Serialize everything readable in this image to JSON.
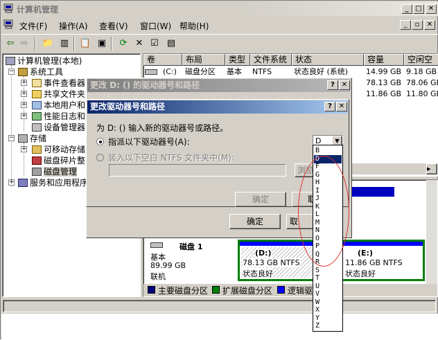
{
  "window": {
    "title": "计算机管理"
  },
  "menu": [
    "文件(F)",
    "操作(A)",
    "查看(V)",
    "窗口(W)",
    "帮助(H)"
  ],
  "tree": {
    "root": "计算机管理(本地)",
    "system_tools": "系统工具",
    "event_viewer": "事件查看器",
    "shared_folders": "共享文件夹",
    "local_users": "本地用户和",
    "perf_logs": "性能日志和",
    "device_manager": "设备管理器",
    "storage": "存储",
    "removable": "可移动存储",
    "defrag": "磁盘碎片整",
    "disk_mgmt": "磁盘管理",
    "services": "服务和应用程序"
  },
  "columns": [
    "卷",
    "布局",
    "类型",
    "文件系统",
    "状态",
    "容量",
    "空闲空"
  ],
  "volumes": [
    {
      "vol": "(C:)",
      "layout": "磁盘分区",
      "type": "基本",
      "fs": "NTFS",
      "status": "状态良好 (系统)",
      "cap": "14.99 GB",
      "free": "9.18 GB"
    },
    {
      "vol": "",
      "layout": "",
      "type": "",
      "fs": "",
      "status": "",
      "cap": "78.13 GB",
      "free": "78.06 GB"
    },
    {
      "vol": "",
      "layout": "",
      "type": "",
      "fs": "",
      "status": "",
      "cap": "11.86 GB",
      "free": "11.80 GB"
    }
  ],
  "disk1": {
    "name": "磁盘 1",
    "kind": "基本",
    "size": "89.99 GB",
    "state": "联机",
    "part_d_label": "(D:)",
    "part_d_size": "78.13 GB NTFS",
    "part_d_status": "状态良好",
    "part_e_label": "(E:)",
    "part_e_size": "11.86 GB NTFS",
    "part_e_status": "状态良好"
  },
  "legend": [
    "主要磁盘分区",
    "扩展磁盘分区",
    "逻辑驱"
  ],
  "dialog1": {
    "title": "更改 D: () 的驱动器号和路径",
    "ok": "确定",
    "cancel": "取"
  },
  "dialog2": {
    "title": "更改驱动器号和路径",
    "prompt": "为 D: () 输入新的驱动器号或路径。",
    "opt_letter": "指派以下驱动器号(A):",
    "opt_folder": "装入以下空白 NTFS 文件夹中(M):",
    "browse": "浏览",
    "ok": "确定",
    "cancel": "取",
    "selected_letter": "D"
  },
  "drive_letters": [
    "B",
    "D",
    "F",
    "G",
    "H",
    "I",
    "J",
    "K",
    "L",
    "M",
    "N",
    "O",
    "P",
    "Q",
    "R",
    "S",
    "T",
    "U",
    "V",
    "W",
    "X",
    "Y",
    "Z"
  ],
  "colors": {
    "primary": "#0a246a",
    "extended": "#008000",
    "logical": "#0000ff"
  }
}
